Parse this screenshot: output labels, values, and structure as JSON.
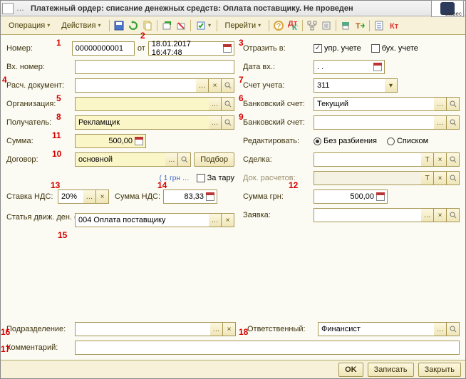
{
  "window": {
    "title": "Платежный ордер: списание денежных средств: Оплата поставщику. Не проведен"
  },
  "logo_text": "stosec",
  "toolbar": {
    "operation": "Операция",
    "actions": "Действия",
    "go": "Перейти"
  },
  "labels": {
    "number": "Номер:",
    "from": "от",
    "vh_number": "Вх. номер:",
    "rasch_doc": "Расч. документ:",
    "org": "Организация:",
    "recipient": "Получатель:",
    "sum": "Сумма:",
    "contract": "Договор:",
    "rate_hint": "( 1 грн …",
    "za_taru": "За тару",
    "vat_rate": "Ставка НДС:",
    "vat_sum": "Сумма НДС:",
    "article": "Статья движ. ден. средств:",
    "subdivision": "Подразделение:",
    "comment": "Комментарий:",
    "reflect": "Отразить в:",
    "upr": "упр. учете",
    "buh": "бух. учете",
    "date_vh": "Дата вх.:",
    "account": "Счет учета:",
    "bank_account": "Банковский счет:",
    "edit": "Редактировать:",
    "no_split": "Без разбиения",
    "list": "Списком",
    "deal": "Сделка:",
    "doc_calc": "Док. расчетов:",
    "sum_grn": "Сумма грн:",
    "request": "Заявка:",
    "responsible": "Ответственный:",
    "podbor": "Подбор"
  },
  "values": {
    "number": "00000000001",
    "date": "18.01.2017 16:47:48",
    "recipient": "Рекламщик",
    "sum": "500,00",
    "contract": "основной",
    "vat_rate": "20%",
    "vat_sum": "83,33",
    "article": "004 Оплата поставщику",
    "account": "311",
    "bank_account": "Текущий",
    "sum_grn": "500,00",
    "responsible": "Финансист",
    "date_vh": "  .  .    "
  },
  "footer": {
    "ok": "OK",
    "save": "Записать",
    "close": "Закрыть"
  },
  "annotations": [
    "1",
    "2",
    "3",
    "4",
    "5",
    "6",
    "7",
    "8",
    "9",
    "10",
    "11",
    "12",
    "13",
    "14",
    "15",
    "16",
    "17",
    "18"
  ]
}
